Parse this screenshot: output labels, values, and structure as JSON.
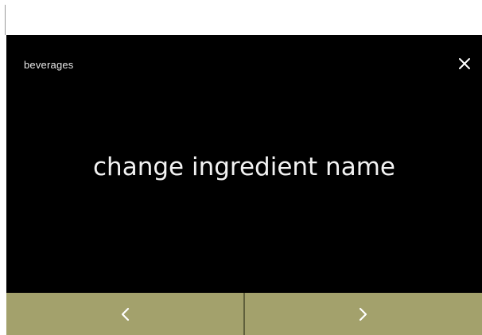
{
  "screen": {
    "breadcrumb": "beverages",
    "title": "change ingredient name"
  },
  "icons": {
    "close": "close-icon",
    "previous": "chevron-left-icon",
    "next": "chevron-right-icon"
  },
  "colors": {
    "background": "#000000",
    "text": "#f2f2f2",
    "nav_bar": "#a3a16c",
    "nav_divider": "#5f5f3c"
  }
}
